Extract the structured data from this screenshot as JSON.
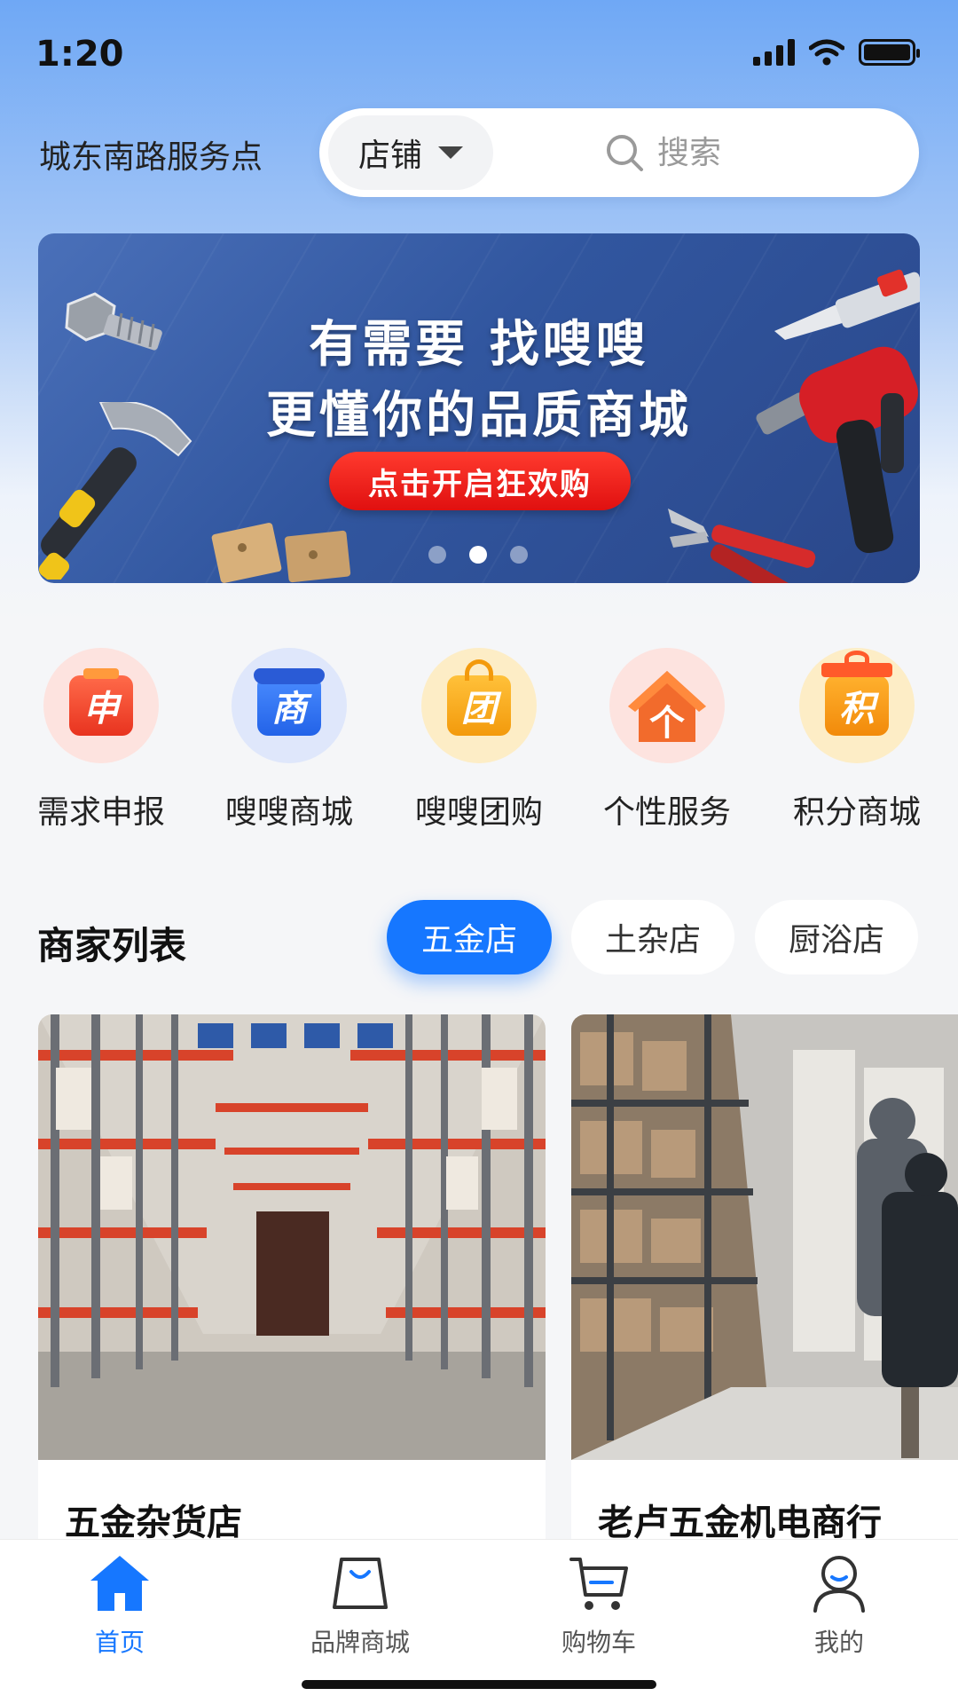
{
  "status_bar": {
    "time": "1:20"
  },
  "header": {
    "location": "城东南路服务点",
    "search_scope": "店铺",
    "search_placeholder": "搜索"
  },
  "banner": {
    "line1": "有需要  找嗖嗖",
    "line2": "更懂你的品质商城",
    "cta": "点击开启狂欢购",
    "active_slide": 2,
    "slide_count": 3
  },
  "categories": [
    {
      "label": "需求申报",
      "glyph": "申",
      "icon": "report-icon"
    },
    {
      "label": "嗖嗖商城",
      "glyph": "商",
      "icon": "mall-icon"
    },
    {
      "label": "嗖嗖团购",
      "glyph": "团",
      "icon": "group-buy-icon"
    },
    {
      "label": "个性服务",
      "glyph": "个",
      "icon": "house-icon"
    },
    {
      "label": "积分商城",
      "glyph": "积",
      "icon": "gift-icon"
    }
  ],
  "merchants": {
    "title": "商家列表",
    "filters": [
      "五金店",
      "土杂店",
      "厨浴店"
    ],
    "active_filter": "五金店",
    "shops": [
      {
        "name": "五金杂货店"
      },
      {
        "name": "老卢五金机电商行"
      }
    ]
  },
  "tabbar": {
    "items": [
      {
        "label": "首页",
        "icon": "home-icon",
        "active": true
      },
      {
        "label": "品牌商城",
        "icon": "shopping-bag-icon",
        "active": false
      },
      {
        "label": "购物车",
        "icon": "cart-icon",
        "active": false
      },
      {
        "label": "我的",
        "icon": "user-icon",
        "active": false
      }
    ]
  },
  "colors": {
    "accent": "#1677ff",
    "banner_cta": "#e81b1b"
  }
}
